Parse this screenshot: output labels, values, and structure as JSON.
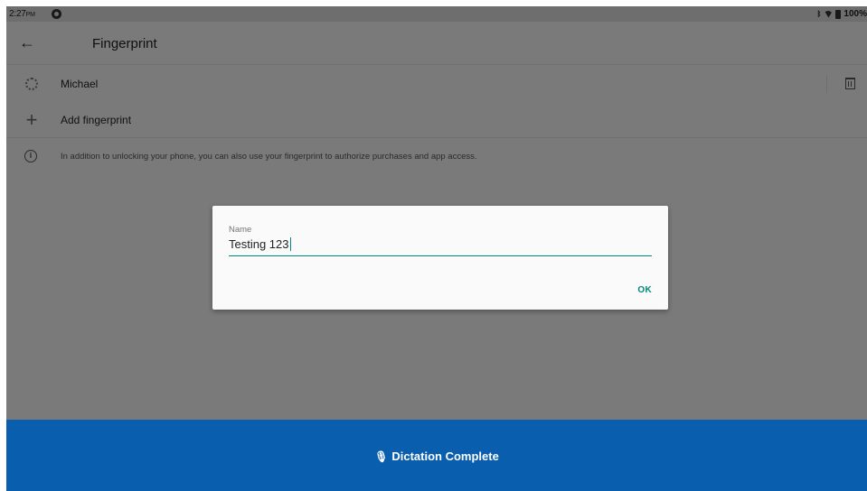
{
  "status_bar": {
    "time": "2:27",
    "ampm": "PM",
    "battery": "100%"
  },
  "app_bar": {
    "title": "Fingerprint"
  },
  "fingerprints": [
    {
      "label": "Michael"
    }
  ],
  "add_fingerprint": {
    "label": "Add fingerprint"
  },
  "info": {
    "text": "In addition to unlocking your phone, you can also use your fingerprint to authorize purchases and app access."
  },
  "dialog": {
    "field_label": "Name",
    "field_value": "Testing 123",
    "ok_label": "OK"
  },
  "dictation": {
    "label": "Dictation Complete"
  },
  "colors": {
    "accent": "#00897b",
    "dictation_bg": "#0a5eae"
  },
  "icons": [
    "back-arrow-icon",
    "fingerprint-icon",
    "trash-icon",
    "plus-icon",
    "info-icon",
    "mic-icon",
    "bluetooth-icon",
    "wifi-icon",
    "battery-icon"
  ]
}
